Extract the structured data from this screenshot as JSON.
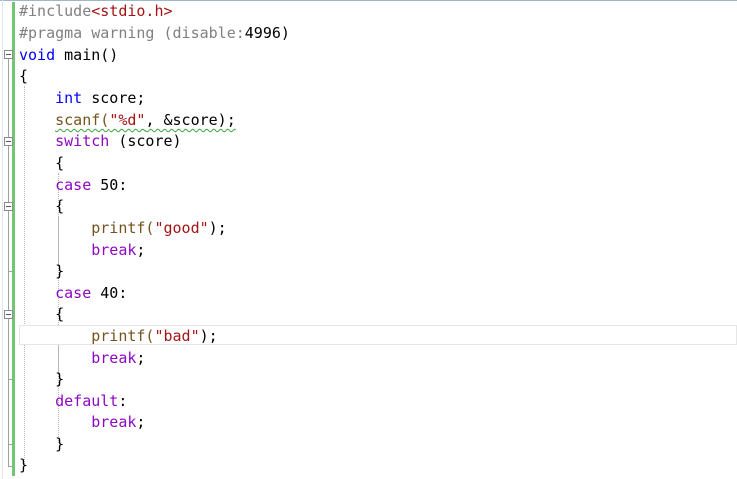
{
  "code_lines": [
    {
      "text": "#include<stdio.h>"
    },
    {
      "text": "#pragma warning (disable:4996)"
    },
    {
      "text": "void main()"
    },
    {
      "text": "{"
    },
    {
      "text": "    int score;"
    },
    {
      "text": "    scanf(\"%d\", &score);"
    },
    {
      "text": "    switch (score)"
    },
    {
      "text": "    {"
    },
    {
      "text": "    case 50:"
    },
    {
      "text": "    {"
    },
    {
      "text": "        printf(\"good\");"
    },
    {
      "text": "        break;"
    },
    {
      "text": "    }"
    },
    {
      "text": "    case 40:"
    },
    {
      "text": "    {"
    },
    {
      "text": "        printf(\"bad\");"
    },
    {
      "text": "        break;"
    },
    {
      "text": "    }"
    },
    {
      "text": "    default:"
    },
    {
      "text": "        break;"
    },
    {
      "text": "    }"
    },
    {
      "text": "}"
    }
  ],
  "tokens": {
    "include": "#include",
    "stdio": "<stdio.h>",
    "pragma": "#pragma warning",
    "disable_open": " (disable:",
    "disable_num": "4996",
    "disable_close": ")",
    "void": "void",
    "main": " main()",
    "open_brace": "{",
    "close_brace": "}",
    "int": "int",
    "score_decl": " score;",
    "scanf": "scanf(",
    "fmt_d": "\"%d\"",
    "scanf_args": ", &score);",
    "switch": "switch",
    "switch_arg": " (score)",
    "case": "case",
    "case1_val": " 50:",
    "case2_val": " 40:",
    "printf": "printf(",
    "good": "\"good\"",
    "bad": "\"bad\"",
    "printf_close": ");",
    "break": "break",
    "semicolon": ";",
    "default": "default",
    "colon": ":"
  },
  "colors": {
    "keyword": "#0000ff",
    "preprocessor": "#808080",
    "string": "#a31515",
    "control": "#8f08c4",
    "function": "#74531f",
    "change_bar": "#72c572"
  },
  "icons": [
    "fold-collapse-icon"
  ]
}
